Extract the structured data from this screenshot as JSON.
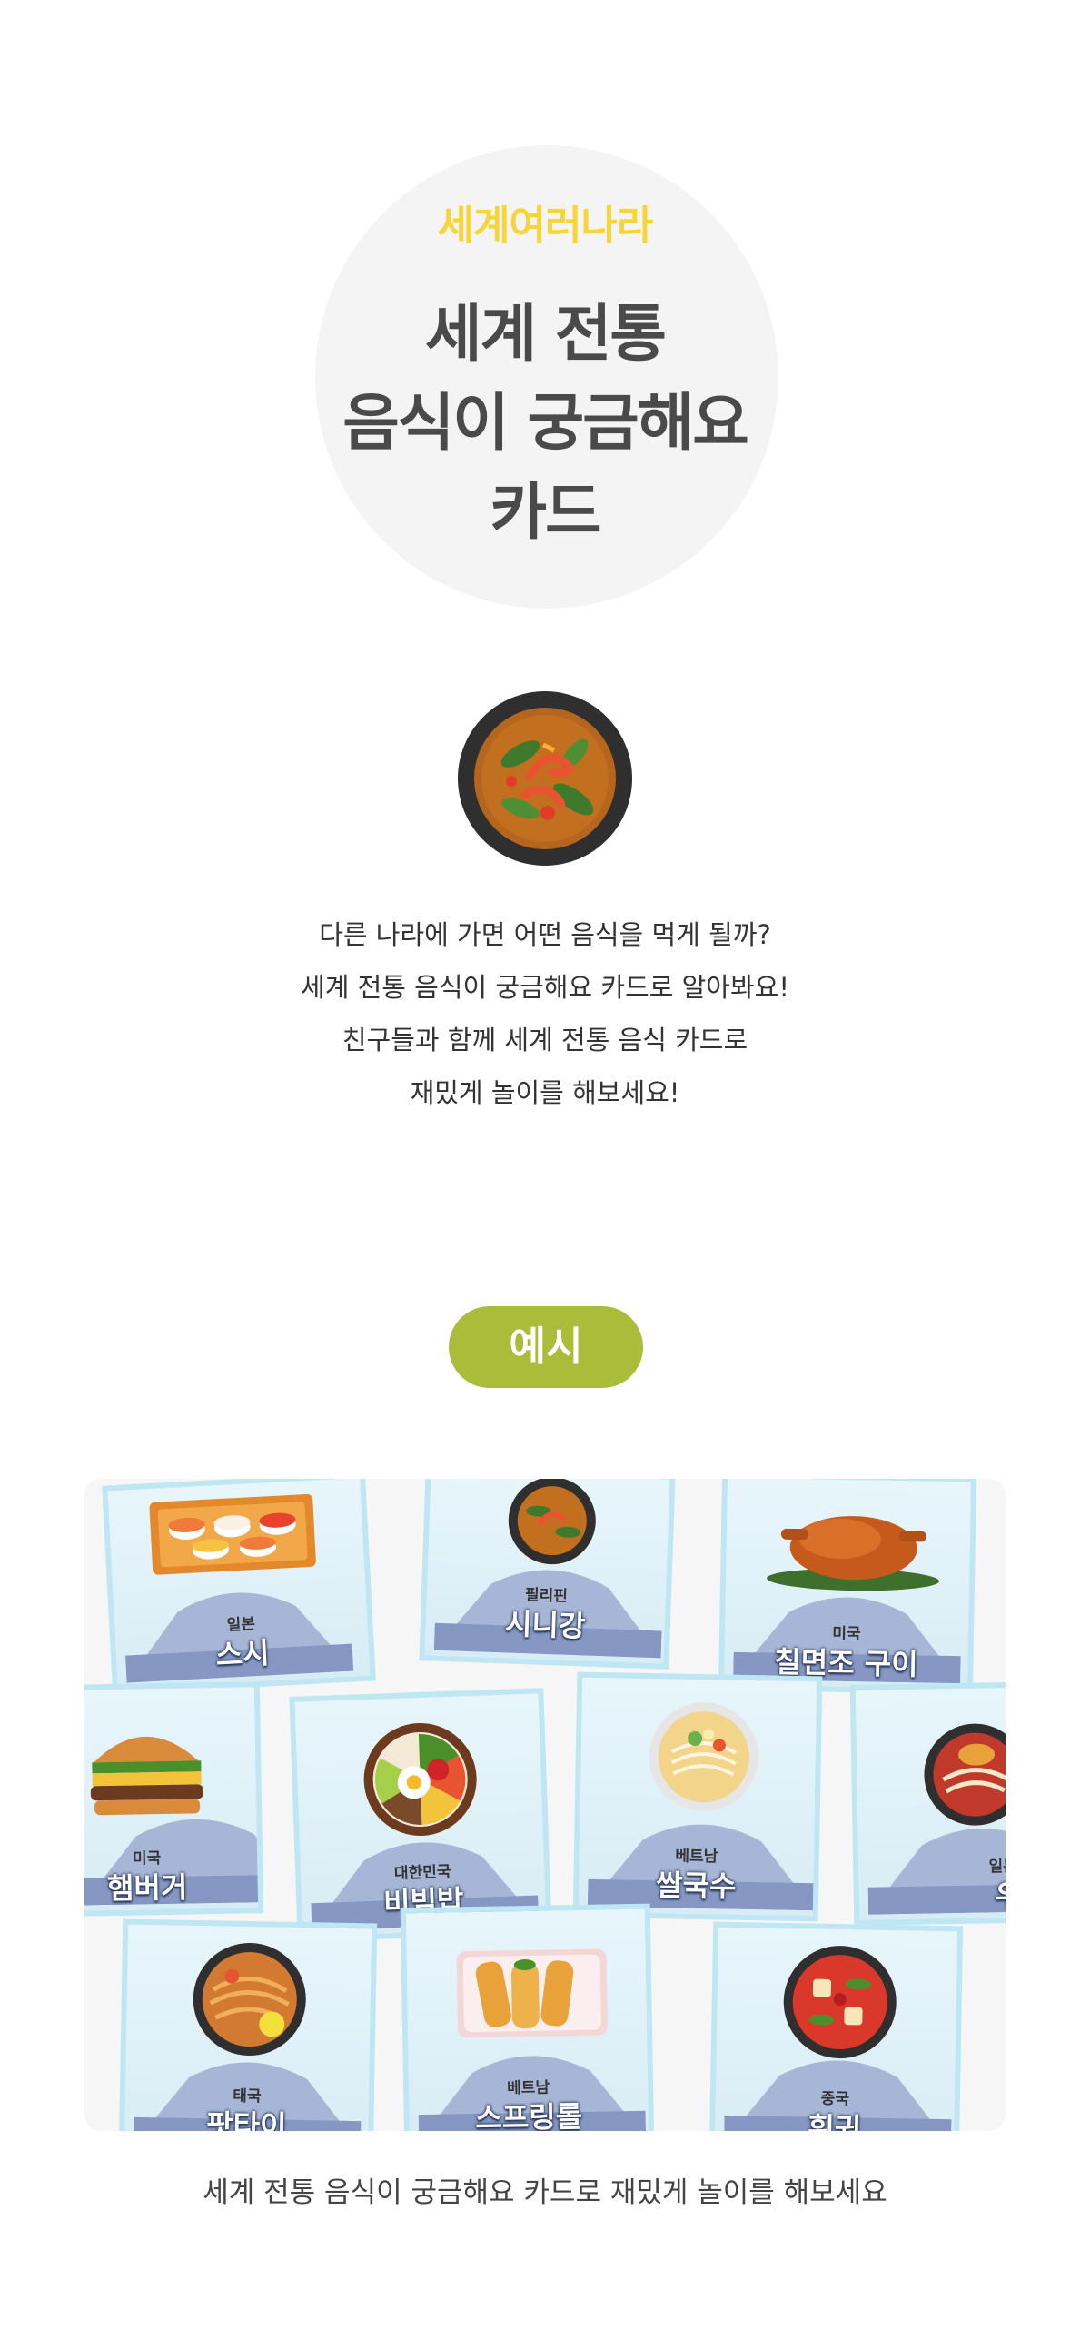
{
  "hero": {
    "subtitle": "세계여러나라",
    "title_lines": [
      "세계 전통",
      "음식이 궁금해요",
      "카드"
    ]
  },
  "dish_icon": "tom-yum-soup-bowl-icon",
  "intro": {
    "lines": [
      "다른 나라에 가면 어떤 음식을 먹게 될까?",
      "세계 전통 음식이 궁금해요 카드로 알아봐요!",
      "친구들과 함께 세계 전통 음식 카드로",
      "재밌게 놀이를 해보세요!"
    ]
  },
  "example_label": "예시",
  "cards": [
    {
      "country": "일본",
      "food": "스시",
      "icon": "sushi-icon"
    },
    {
      "country": "필리핀",
      "food": "시니강",
      "icon": "sinigang-icon"
    },
    {
      "country": "미국",
      "food": "칠면조 구이",
      "icon": "roast-turkey-icon"
    },
    {
      "country": "미국",
      "food": "햄버거",
      "icon": "hamburger-icon"
    },
    {
      "country": "대한민국",
      "food": "비빔밥",
      "icon": "bibimbap-icon"
    },
    {
      "country": "베트남",
      "food": "쌀국수",
      "icon": "pho-icon"
    },
    {
      "country": "일본",
      "food": "우동",
      "icon": "udon-icon"
    },
    {
      "country": "태국",
      "food": "팟타이",
      "icon": "pad-thai-icon"
    },
    {
      "country": "베트남",
      "food": "스프링롤",
      "icon": "spring-roll-icon"
    },
    {
      "country": "중국",
      "food": "훠궈",
      "icon": "hotpot-icon"
    }
  ],
  "caption": "세계 전통 음식이 궁금해요 카드로 재밌게 놀이를 해보세요",
  "colors": {
    "accent_yellow": "#f7d53a",
    "pill_green": "#a9bd3a",
    "card_border": "#bfe6f3"
  }
}
